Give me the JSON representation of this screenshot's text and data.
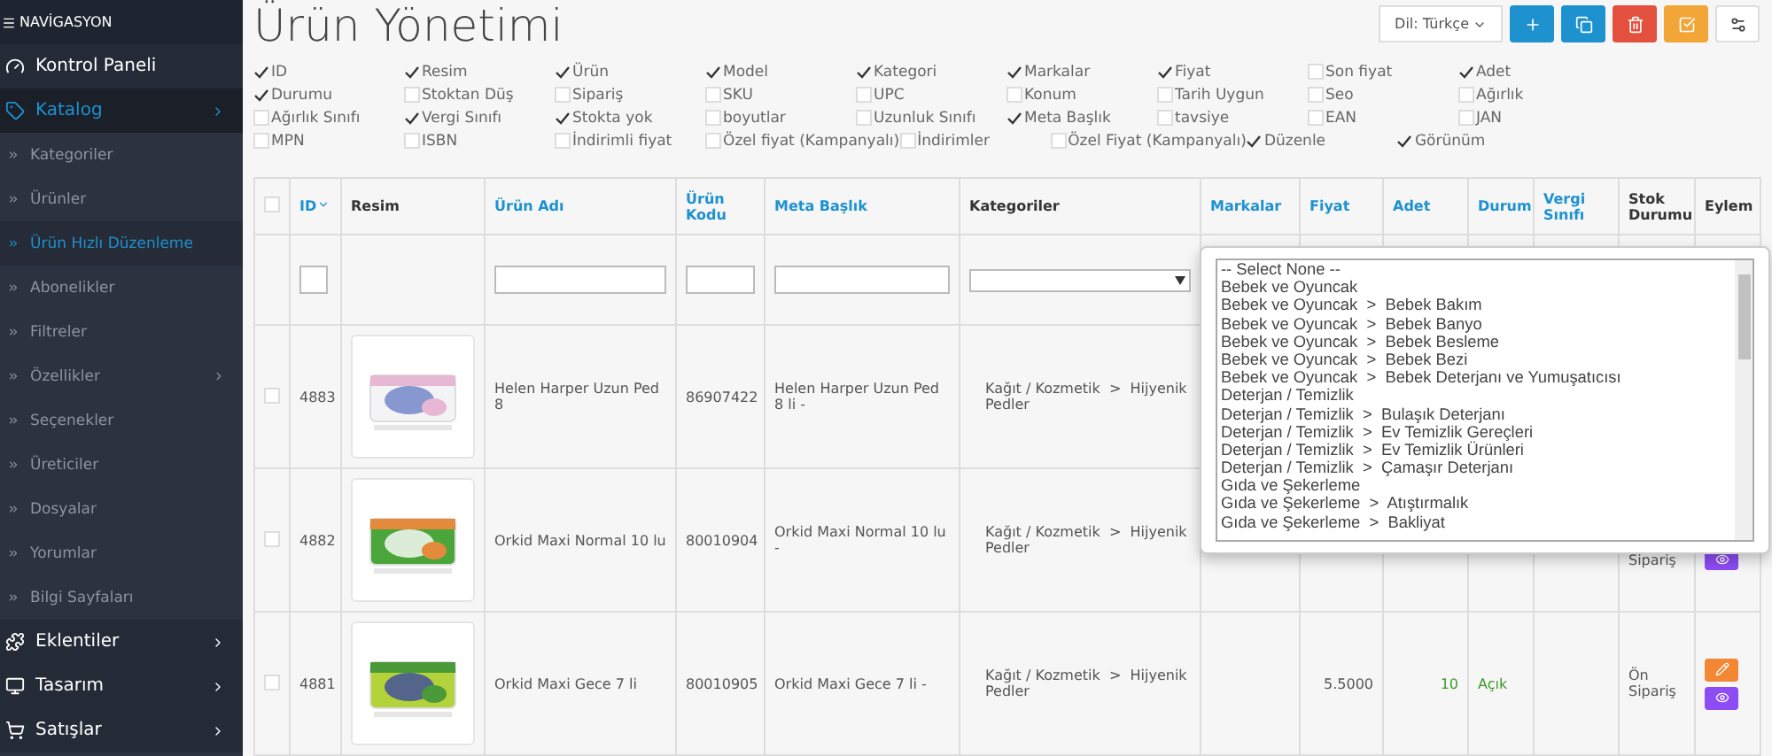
{
  "sidebar": {
    "title": "NAVİGASYON",
    "items": [
      {
        "label": "Kontrol Paneli",
        "selected": false,
        "has_arrow": false
      },
      {
        "label": "Katalog",
        "selected": true,
        "has_arrow": true,
        "children": [
          {
            "label": "Kategoriler",
            "selected": false,
            "has_arrow": false
          },
          {
            "label": "Ürünler",
            "selected": false,
            "has_arrow": false
          },
          {
            "label": "Ürün Hızlı Düzenleme",
            "selected": true,
            "has_arrow": false
          },
          {
            "label": "Abonelikler",
            "selected": false,
            "has_arrow": false
          },
          {
            "label": "Filtreler",
            "selected": false,
            "has_arrow": false
          },
          {
            "label": "Özellikler",
            "selected": false,
            "has_arrow": true
          },
          {
            "label": "Seçenekler",
            "selected": false,
            "has_arrow": false
          },
          {
            "label": "Üreticiler",
            "selected": false,
            "has_arrow": false
          },
          {
            "label": "Dosyalar",
            "selected": false,
            "has_arrow": false
          },
          {
            "label": "Yorumlar",
            "selected": false,
            "has_arrow": false
          },
          {
            "label": "Bilgi Sayfaları",
            "selected": false,
            "has_arrow": false
          }
        ]
      },
      {
        "label": "Eklentiler",
        "selected": false,
        "has_arrow": true
      },
      {
        "label": "Tasarım",
        "selected": false,
        "has_arrow": true
      },
      {
        "label": "Satışlar",
        "selected": false,
        "has_arrow": true
      }
    ]
  },
  "page": {
    "title": "Ürün Yönetimi"
  },
  "toolbar": {
    "language": "Dil: Türkçe",
    "buttons": [
      {
        "kind": "add"
      },
      {
        "kind": "copy"
      },
      {
        "kind": "delete"
      },
      {
        "kind": "check"
      },
      {
        "kind": "settings"
      }
    ]
  },
  "column_toggles": [
    {
      "label": "ID",
      "checked": true
    },
    {
      "label": "Resim",
      "checked": true
    },
    {
      "label": "Ürün",
      "checked": true
    },
    {
      "label": "Model",
      "checked": true
    },
    {
      "label": "Kategori",
      "checked": true
    },
    {
      "label": "Markalar",
      "checked": true
    },
    {
      "label": "Fiyat",
      "checked": true
    },
    {
      "label": "Son fiyat",
      "checked": false
    },
    {
      "label": "Adet",
      "checked": true
    },
    {
      "label": "Durumu",
      "checked": true
    },
    {
      "label": "Stoktan Düş",
      "checked": false
    },
    {
      "label": "Sipariş",
      "checked": false
    },
    {
      "label": "SKU",
      "checked": false
    },
    {
      "label": "UPC",
      "checked": false
    },
    {
      "label": "Konum",
      "checked": false
    },
    {
      "label": "Tarih Uygun",
      "checked": false
    },
    {
      "label": "Seo",
      "checked": false
    },
    {
      "label": "Ağırlık",
      "checked": false
    },
    {
      "label": "Ağırlık Sınıfı",
      "checked": false
    },
    {
      "label": "Vergi Sınıfı",
      "checked": true
    },
    {
      "label": "Stokta yok",
      "checked": true
    },
    {
      "label": "boyutlar",
      "checked": false
    },
    {
      "label": "Uzunluk Sınıfı",
      "checked": false
    },
    {
      "label": "Meta Başlık",
      "checked": true
    },
    {
      "label": "tavsiye",
      "checked": false
    },
    {
      "label": "EAN",
      "checked": false
    },
    {
      "label": "JAN",
      "checked": false
    },
    {
      "label": "MPN",
      "checked": false
    },
    {
      "label": "ISBN",
      "checked": false
    },
    {
      "label": "İndirimli fiyat",
      "checked": false
    },
    {
      "label": "Özel fiyat (Kampanyalı)",
      "checked": false
    },
    {
      "label": "İndirimler",
      "checked": false
    },
    {
      "label": "Özel Fiyat (Kampanyalı)",
      "checked": false
    },
    {
      "label": "Düzenle",
      "checked": true
    },
    {
      "label": "Görünüm",
      "checked": true
    }
  ],
  "table": {
    "select_all": {
      "checked": false
    },
    "columns": [
      {
        "label": "ID",
        "link": true,
        "sorted": true
      },
      {
        "label": "Resim",
        "link": false,
        "sorted": false
      },
      {
        "label": "Ürün Adı",
        "link": true,
        "sorted": false
      },
      {
        "label": "Ürün Kodu",
        "link": true,
        "sorted": false
      },
      {
        "label": "Meta Başlık",
        "link": true,
        "sorted": false
      },
      {
        "label": "Kategoriler",
        "link": false,
        "sorted": false
      },
      {
        "label": "Markalar",
        "link": true,
        "sorted": false
      },
      {
        "label": "Fiyat",
        "link": true,
        "sorted": false
      },
      {
        "label": "Adet",
        "link": true,
        "sorted": false
      },
      {
        "label": "Durum",
        "link": true,
        "sorted": false
      },
      {
        "label": "Vergi Sınıfı",
        "link": true,
        "sorted": false
      },
      {
        "label": "Stok Durumu",
        "link": false,
        "sorted": false
      },
      {
        "label": "Eylem",
        "link": false,
        "sorted": false
      }
    ],
    "rows": [
      {
        "checked": false,
        "id": "4883",
        "image": {
          "kind": "picture"
        },
        "name": "Helen Harper Uzun Ped 8",
        "code": "86907422",
        "meta": "Helen Harper Uzun Ped 8 li -",
        "category": "Kağıt / Kozmetik  >  Hijyenik Pedler"
      },
      {
        "checked": false,
        "id": "4882",
        "image": {
          "kind": "picture"
        },
        "name": "Orkid Maxi Normal 10 lu",
        "code": "80010904",
        "meta": "Orkid Maxi Normal 10 lu -",
        "category": "Kağıt / Kozmetik  >  Hijyenik Pedler",
        "stock": "Sipariş",
        "actions": [
          {
            "kind": "view"
          }
        ]
      },
      {
        "checked": false,
        "id": "4881",
        "image": {
          "kind": "picture"
        },
        "name": "Orkid Maxi Gece 7 li",
        "code": "80010905",
        "meta": "Orkid Maxi Gece 7 li -",
        "category": "Kağıt / Kozmetik  >  Hijyenik Pedler",
        "price": "5.5000",
        "quantity": "10",
        "status": "Açık",
        "stock": "Ön Sipariş",
        "actions": [
          {
            "kind": "edit"
          },
          {
            "kind": "view"
          }
        ]
      }
    ]
  },
  "category_dropdown": {
    "expanded": true,
    "options": [
      "-- Select None --",
      "Bebek ve Oyuncak",
      "Bebek ve Oyuncak  >  Bebek Bakım",
      "Bebek ve Oyuncak  >  Bebek Banyo",
      "Bebek ve Oyuncak  >  Bebek Besleme",
      "Bebek ve Oyuncak  >  Bebek Bezi",
      "Bebek ve Oyuncak  >  Bebek Deterjanı ve Yumuşatıcısı",
      "Deterjan / Temizlik",
      "Deterjan / Temizlik  >  Bulaşık Deterjanı",
      "Deterjan / Temizlik  >  Ev Temizlik Gereçleri",
      "Deterjan / Temizlik  >  Ev Temizlik Ürünleri",
      "Deterjan / Temizlik  >  Çamaşır Deterjanı",
      "Gıda ve Şekerleme",
      "Gıda ve Şekerleme  >  Atıştırmalık",
      "Gıda ve Şekerleme  >  Bakliyat"
    ]
  }
}
